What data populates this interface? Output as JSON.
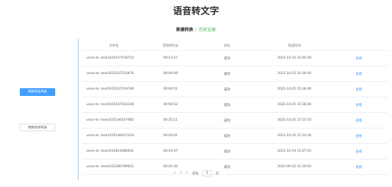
{
  "title": "语音转文字",
  "subnav": {
    "new_task": "新建转换",
    "separator": "|",
    "history": "历史记录",
    "history_color": "#36b24a"
  },
  "sidebar": {
    "buttons": [
      {
        "label": "转换完成列表",
        "active": true
      },
      {
        "label": "转换等待列表",
        "active": false
      }
    ],
    "active_color": "#409eff"
  },
  "table": {
    "headers": [
      "文件名",
      "音频的时长",
      "状态",
      "完成时间",
      ""
    ],
    "rows": [
      {
        "file": "voice-to -text1635147536722",
        "duration": "00:13:27",
        "status": "成功",
        "time": "2021-10-25 15:40:30",
        "action": "查看"
      },
      {
        "file": "voice-to -text1635147533676",
        "duration": "00:00:09",
        "status": "成功",
        "time": "2021-10-25 15:39:20",
        "action": "查看"
      },
      {
        "file": "voice-to -text1635147519746",
        "duration": "00:00:51",
        "status": "成功",
        "time": "2021-10-25 15:38:40",
        "action": "查看"
      },
      {
        "file": "voice-to -text1635147503146",
        "duration": "00:00:52",
        "status": "成功",
        "time": "2021-10-25 15:38:30",
        "action": "查看"
      },
      {
        "file": "voice-to -text1635146147682",
        "duration": "00:25:11",
        "status": "成功",
        "time": "2021-10-25 15:15:50",
        "action": "查看"
      },
      {
        "file": "voice-to -text1635146037314",
        "duration": "00:02:01",
        "status": "成功",
        "time": "2021-10-25 15:14:30",
        "action": "查看"
      },
      {
        "file": "voice-to -text1634612686041",
        "duration": "00:14:07",
        "status": "成功",
        "time": "2021-10-19 11:07:10",
        "action": "查看"
      },
      {
        "file": "voice-to -text1632280789621",
        "duration": "00:05:36",
        "status": "成功",
        "time": "2021-09-22 11:19:50",
        "action": "查看"
      }
    ],
    "action_color": "#409eff"
  },
  "pagination": {
    "prev": "<",
    "current_page": "1",
    "next": ">",
    "goto_label": "前往",
    "goto_value": "1",
    "page_suffix": "页"
  }
}
